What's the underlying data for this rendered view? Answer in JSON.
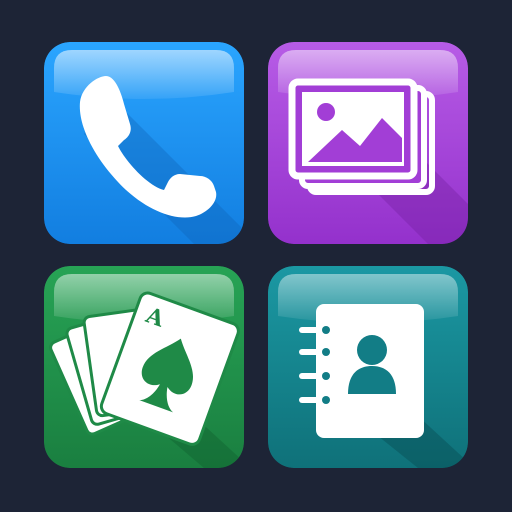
{
  "icons": [
    {
      "name": "phone-icon",
      "color": "#1a8cf0",
      "shadow": "#0f6cc2"
    },
    {
      "name": "gallery-icon",
      "color": "#a23ed6",
      "shadow": "#7e24ad"
    },
    {
      "name": "cards-icon",
      "color": "#1f8a47",
      "shadow": "#136531"
    },
    {
      "name": "contacts-icon",
      "color": "#127d86",
      "shadow": "#0b5a61"
    }
  ],
  "cards": {
    "rank": "A",
    "suit": "spade"
  },
  "background_color": "#1d2436"
}
